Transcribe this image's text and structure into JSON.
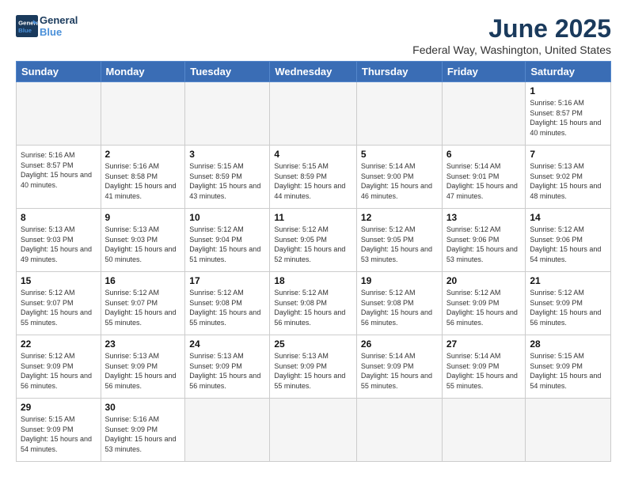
{
  "header": {
    "logo_line1": "General",
    "logo_line2": "Blue",
    "title": "June 2025",
    "subtitle": "Federal Way, Washington, United States"
  },
  "calendar": {
    "days_of_week": [
      "Sunday",
      "Monday",
      "Tuesday",
      "Wednesday",
      "Thursday",
      "Friday",
      "Saturday"
    ],
    "weeks": [
      [
        null,
        null,
        null,
        null,
        null,
        null,
        null
      ]
    ],
    "cells": [
      [
        null,
        null,
        null,
        null,
        null,
        null,
        {
          "day": 1,
          "sunrise": "5:16 AM",
          "sunset": "8:57 PM",
          "daylight": "15 hours and 40 minutes."
        }
      ],
      [
        {
          "day": null,
          "sunrise": "5:16 AM",
          "sunset": "8:57 PM",
          "daylight": "15 hours and 40 minutes."
        },
        {
          "day": 2,
          "sunrise": "5:16 AM",
          "sunset": "8:58 PM",
          "daylight": "15 hours and 41 minutes."
        },
        {
          "day": 3,
          "sunrise": "5:15 AM",
          "sunset": "8:59 PM",
          "daylight": "15 hours and 43 minutes."
        },
        {
          "day": 4,
          "sunrise": "5:15 AM",
          "sunset": "8:59 PM",
          "daylight": "15 hours and 44 minutes."
        },
        {
          "day": 5,
          "sunrise": "5:14 AM",
          "sunset": "9:00 PM",
          "daylight": "15 hours and 46 minutes."
        },
        {
          "day": 6,
          "sunrise": "5:14 AM",
          "sunset": "9:01 PM",
          "daylight": "15 hours and 47 minutes."
        },
        {
          "day": 7,
          "sunrise": "5:13 AM",
          "sunset": "9:02 PM",
          "daylight": "15 hours and 48 minutes."
        }
      ],
      [
        {
          "day": 8,
          "sunrise": "5:13 AM",
          "sunset": "9:03 PM",
          "daylight": "15 hours and 49 minutes."
        },
        {
          "day": 9,
          "sunrise": "5:13 AM",
          "sunset": "9:03 PM",
          "daylight": "15 hours and 50 minutes."
        },
        {
          "day": 10,
          "sunrise": "5:12 AM",
          "sunset": "9:04 PM",
          "daylight": "15 hours and 51 minutes."
        },
        {
          "day": 11,
          "sunrise": "5:12 AM",
          "sunset": "9:05 PM",
          "daylight": "15 hours and 52 minutes."
        },
        {
          "day": 12,
          "sunrise": "5:12 AM",
          "sunset": "9:05 PM",
          "daylight": "15 hours and 53 minutes."
        },
        {
          "day": 13,
          "sunrise": "5:12 AM",
          "sunset": "9:06 PM",
          "daylight": "15 hours and 53 minutes."
        },
        {
          "day": 14,
          "sunrise": "5:12 AM",
          "sunset": "9:06 PM",
          "daylight": "15 hours and 54 minutes."
        }
      ],
      [
        {
          "day": 15,
          "sunrise": "5:12 AM",
          "sunset": "9:07 PM",
          "daylight": "15 hours and 55 minutes."
        },
        {
          "day": 16,
          "sunrise": "5:12 AM",
          "sunset": "9:07 PM",
          "daylight": "15 hours and 55 minutes."
        },
        {
          "day": 17,
          "sunrise": "5:12 AM",
          "sunset": "9:08 PM",
          "daylight": "15 hours and 55 minutes."
        },
        {
          "day": 18,
          "sunrise": "5:12 AM",
          "sunset": "9:08 PM",
          "daylight": "15 hours and 56 minutes."
        },
        {
          "day": 19,
          "sunrise": "5:12 AM",
          "sunset": "9:08 PM",
          "daylight": "15 hours and 56 minutes."
        },
        {
          "day": 20,
          "sunrise": "5:12 AM",
          "sunset": "9:09 PM",
          "daylight": "15 hours and 56 minutes."
        },
        {
          "day": 21,
          "sunrise": "5:12 AM",
          "sunset": "9:09 PM",
          "daylight": "15 hours and 56 minutes."
        }
      ],
      [
        {
          "day": 22,
          "sunrise": "5:12 AM",
          "sunset": "9:09 PM",
          "daylight": "15 hours and 56 minutes."
        },
        {
          "day": 23,
          "sunrise": "5:13 AM",
          "sunset": "9:09 PM",
          "daylight": "15 hours and 56 minutes."
        },
        {
          "day": 24,
          "sunrise": "5:13 AM",
          "sunset": "9:09 PM",
          "daylight": "15 hours and 56 minutes."
        },
        {
          "day": 25,
          "sunrise": "5:13 AM",
          "sunset": "9:09 PM",
          "daylight": "15 hours and 55 minutes."
        },
        {
          "day": 26,
          "sunrise": "5:14 AM",
          "sunset": "9:09 PM",
          "daylight": "15 hours and 55 minutes."
        },
        {
          "day": 27,
          "sunrise": "5:14 AM",
          "sunset": "9:09 PM",
          "daylight": "15 hours and 55 minutes."
        },
        {
          "day": 28,
          "sunrise": "5:15 AM",
          "sunset": "9:09 PM",
          "daylight": "15 hours and 54 minutes."
        }
      ],
      [
        {
          "day": 29,
          "sunrise": "5:15 AM",
          "sunset": "9:09 PM",
          "daylight": "15 hours and 54 minutes."
        },
        {
          "day": 30,
          "sunrise": "5:16 AM",
          "sunset": "9:09 PM",
          "daylight": "15 hours and 53 minutes."
        },
        null,
        null,
        null,
        null,
        null
      ]
    ]
  }
}
